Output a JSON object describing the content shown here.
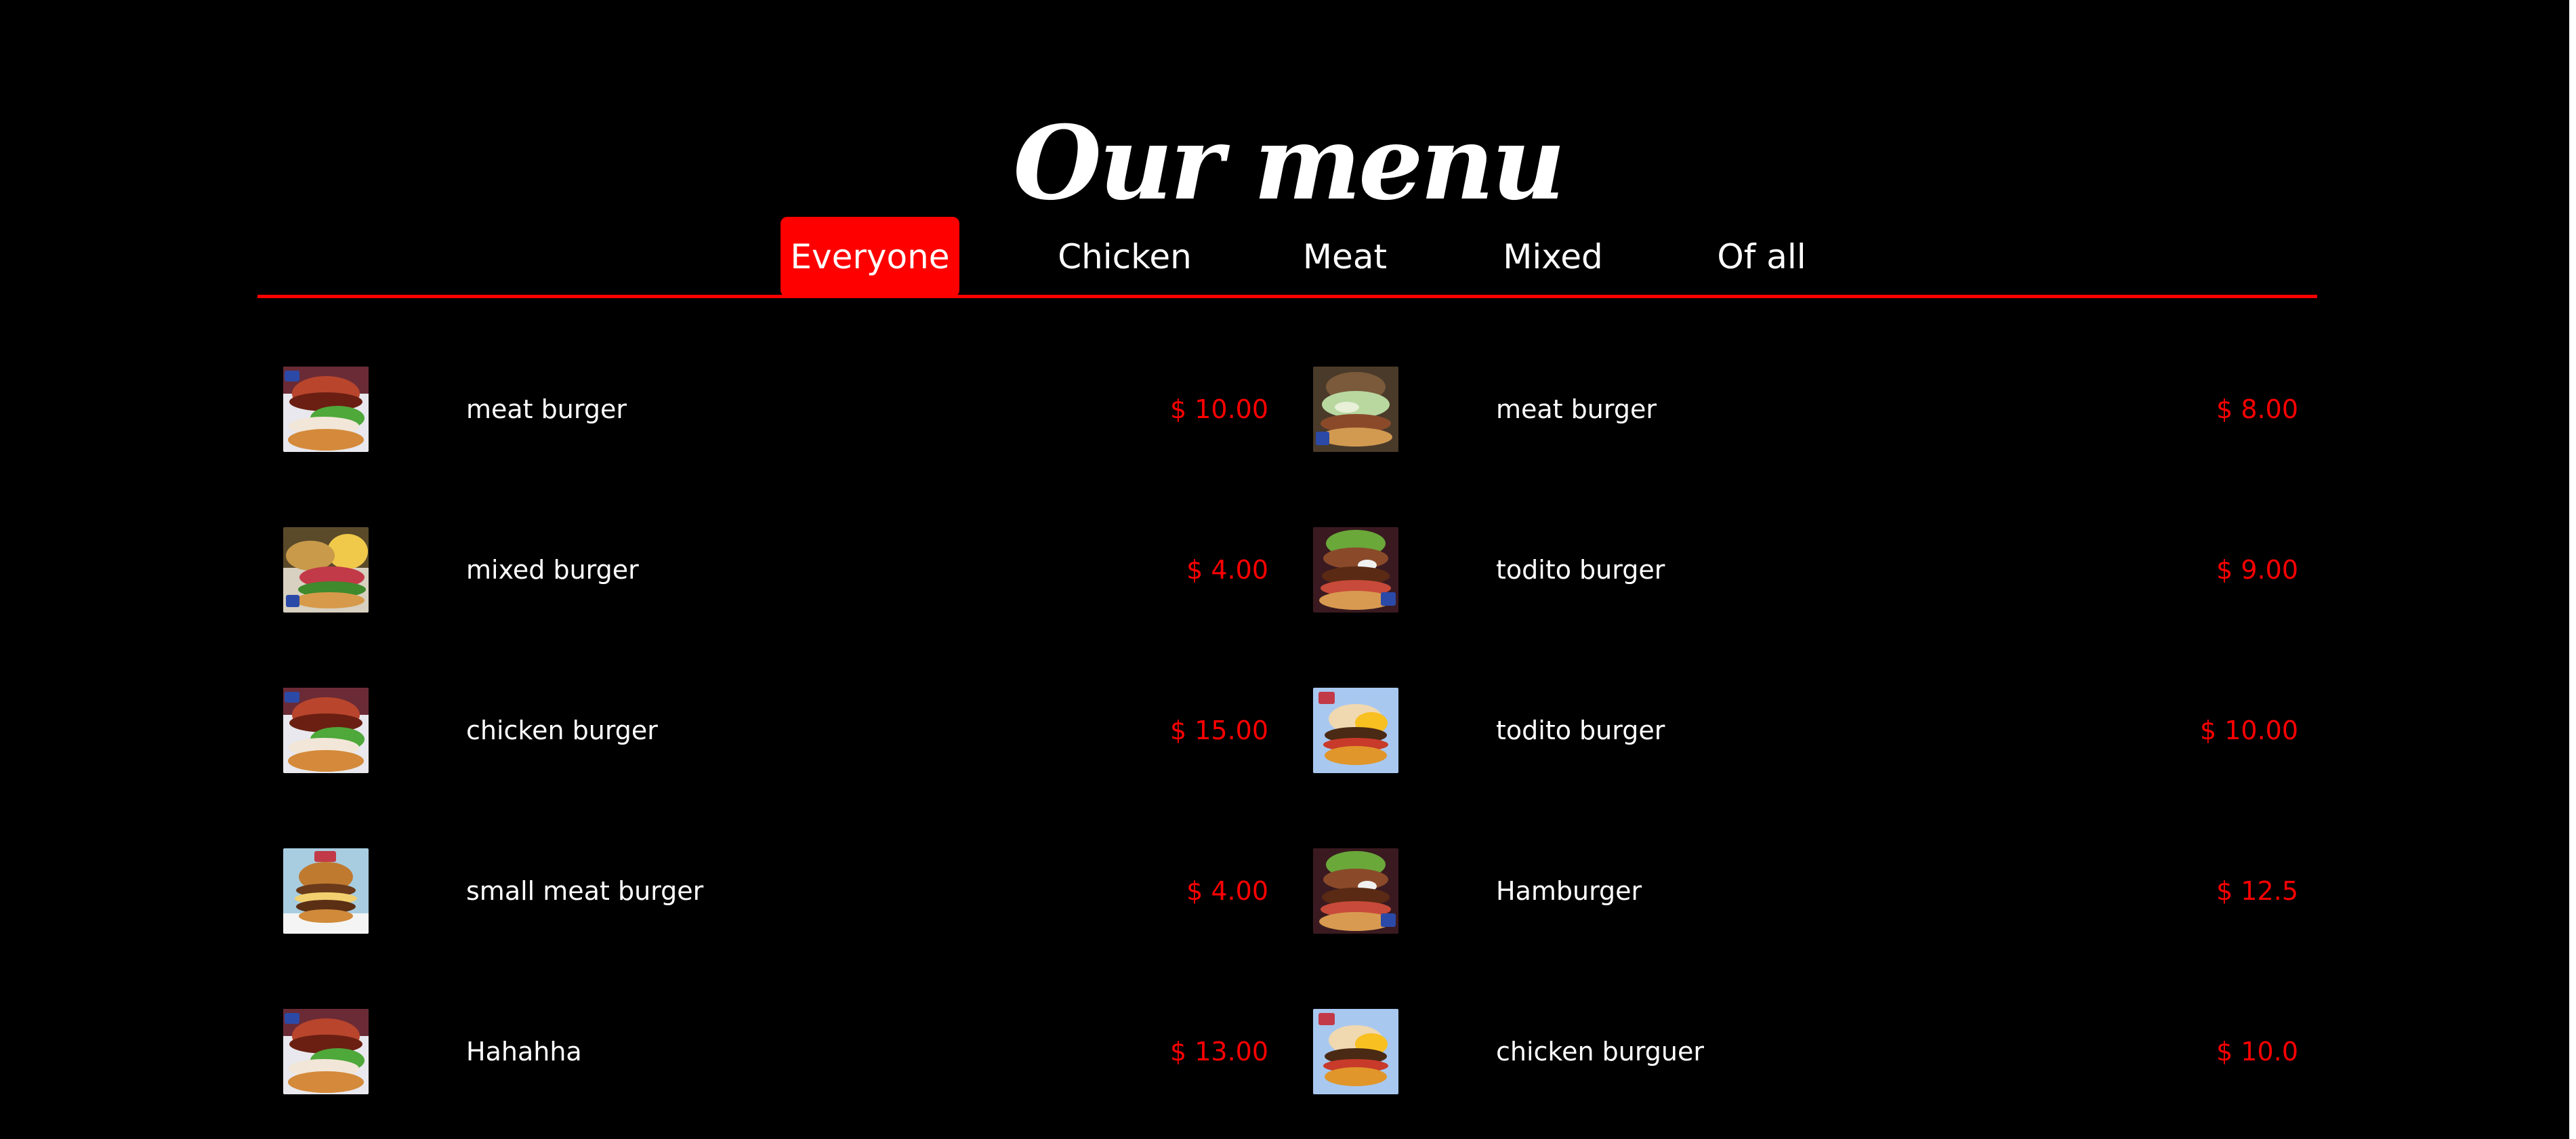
{
  "page": {
    "title": "Our menu"
  },
  "colors": {
    "background": "#000000",
    "accent": "#ff0000",
    "text": "#ffffff"
  },
  "tabs": [
    {
      "label": "Everyone",
      "active": true
    },
    {
      "label": "Chicken",
      "active": false
    },
    {
      "label": "Meat",
      "active": false
    },
    {
      "label": "Mixed",
      "active": false
    },
    {
      "label": "Of all",
      "active": false
    }
  ],
  "menu": {
    "left": [
      {
        "name": "meat burger",
        "price": "$ 10.00",
        "image": "burger-tall-photo"
      },
      {
        "name": "mixed burger",
        "price": "$ 4.00",
        "image": "burger-double-photo"
      },
      {
        "name": "chicken burger",
        "price": "$ 15.00",
        "image": "burger-tall-photo"
      },
      {
        "name": "small meat burger",
        "price": "$ 4.00",
        "image": "burger-classic-photo"
      },
      {
        "name": "Hahahha",
        "price": "$ 13.00",
        "image": "burger-tall-photo"
      }
    ],
    "right": [
      {
        "name": "meat burger",
        "price": "$ 8.00",
        "image": "burger-sauce-photo"
      },
      {
        "name": "todito burger",
        "price": "$ 9.00",
        "image": "burger-loaded-photo"
      },
      {
        "name": "todito burger",
        "price": "$ 10.00",
        "image": "burger-fries-photo"
      },
      {
        "name": "Hamburger",
        "price": "$ 12.5",
        "image": "burger-loaded-photo"
      },
      {
        "name": "chicken burguer",
        "price": "$ 10.0",
        "image": "burger-fries-photo"
      }
    ]
  }
}
